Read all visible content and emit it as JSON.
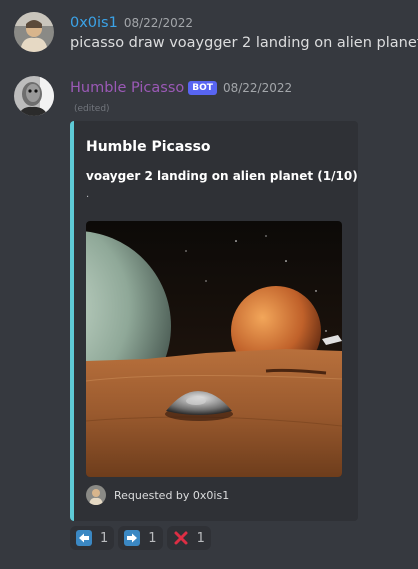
{
  "messages": [
    {
      "username": "0x0is1",
      "username_color": "#3ba3e8",
      "timestamp": "08/22/2022",
      "content": "picasso draw voaygger 2 landing on alien planet"
    },
    {
      "username": "Humble Picasso",
      "username_color": "#9b59b6",
      "bot_tag": "BOT",
      "timestamp": "08/22/2022",
      "edited": "(edited)",
      "embed": {
        "accent_color": "#5ecad6",
        "author": "Humble Picasso",
        "title": "voayger 2 landing on alien planet (1/10)",
        "description": ".",
        "footer": "Requested by 0x0is1"
      }
    }
  ],
  "reactions": [
    {
      "icon": "left-arrow-icon",
      "count": "1"
    },
    {
      "icon": "right-arrow-icon",
      "count": "1"
    },
    {
      "icon": "cross-mark-icon",
      "count": "1"
    }
  ]
}
